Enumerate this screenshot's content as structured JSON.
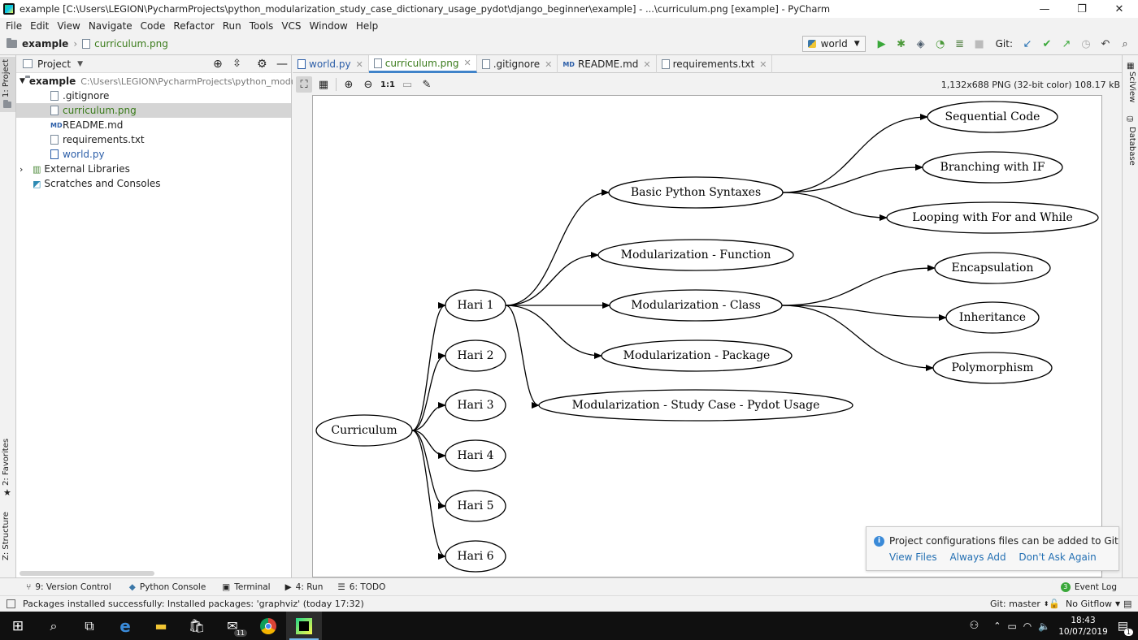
{
  "window": {
    "title": "example [C:\\Users\\LEGION\\PycharmProjects\\python_modularization_study_case_dictionary_usage_pydot\\django_beginner\\example] - ...\\curriculum.png [example] - PyCharm",
    "controls": [
      "—",
      "❐",
      "✕"
    ]
  },
  "menu": [
    "File",
    "Edit",
    "View",
    "Navigate",
    "Code",
    "Refactor",
    "Run",
    "Tools",
    "VCS",
    "Window",
    "Help"
  ],
  "breadcrumb": {
    "project": "example",
    "file": "curriculum.png"
  },
  "run_config": "world",
  "git_label": "Git:",
  "left_strip": {
    "project": "1: Project",
    "favorites": "2: Favorites",
    "structure": "Z: Structure"
  },
  "right_strip": {
    "sciview": "SciView",
    "database": "Database"
  },
  "project_panel": {
    "header": "Project",
    "root": {
      "name": "example",
      "path": "C:\\Users\\LEGION\\PycharmProjects\\python_modulariz"
    },
    "files": [
      {
        "name": ".gitignore",
        "color": "#222222"
      },
      {
        "name": "curriculum.png",
        "color": "#3a7b1a"
      },
      {
        "name": "README.md",
        "color": "#222222"
      },
      {
        "name": "requirements.txt",
        "color": "#222222"
      },
      {
        "name": "world.py",
        "color": "#2c5ea8"
      }
    ],
    "external": "External Libraries",
    "scratches": "Scratches and Consoles"
  },
  "tabs": [
    {
      "label": "world.py",
      "color": "#2c5ea8"
    },
    {
      "label": "curriculum.png",
      "color": "#3a7b1a"
    },
    {
      "label": ".gitignore",
      "color": "#222222"
    },
    {
      "label": "README.md",
      "color": "#222222"
    },
    {
      "label": "requirements.txt",
      "color": "#222222"
    }
  ],
  "image_info": "1,132x688 PNG (32-bit color) 108.17 kB",
  "zoom_label": "1:1",
  "graph": {
    "nodes": {
      "curriculum": "Curriculum",
      "hari1": "Hari 1",
      "hari2": "Hari 2",
      "hari3": "Hari 3",
      "hari4": "Hari 4",
      "hari5": "Hari 5",
      "hari6": "Hari 6",
      "basic": "Basic Python Syntaxes",
      "mod_function": "Modularization - Function",
      "mod_class": "Modularization - Class",
      "mod_package": "Modularization - Package",
      "mod_study": "Modularization - Study Case - Pydot Usage",
      "sequential": "Sequential Code",
      "branching": "Branching with IF",
      "looping": "Looping with For and While",
      "encapsulation": "Encapsulation",
      "inheritance": "Inheritance",
      "polymorphism": "Polymorphism"
    },
    "edges": [
      [
        "curriculum",
        "hari1"
      ],
      [
        "curriculum",
        "hari2"
      ],
      [
        "curriculum",
        "hari3"
      ],
      [
        "curriculum",
        "hari4"
      ],
      [
        "curriculum",
        "hari5"
      ],
      [
        "curriculum",
        "hari6"
      ],
      [
        "hari1",
        "basic"
      ],
      [
        "hari1",
        "mod_function"
      ],
      [
        "hari1",
        "mod_class"
      ],
      [
        "hari1",
        "mod_package"
      ],
      [
        "hari1",
        "mod_study"
      ],
      [
        "basic",
        "sequential"
      ],
      [
        "basic",
        "branching"
      ],
      [
        "basic",
        "looping"
      ],
      [
        "mod_class",
        "encapsulation"
      ],
      [
        "mod_class",
        "inheritance"
      ],
      [
        "mod_class",
        "polymorphism"
      ]
    ]
  },
  "notification": {
    "message": "Project configurations files can be added to Git",
    "actions": [
      "View Files",
      "Always Add",
      "Don't Ask Again"
    ]
  },
  "bottom_tools": [
    {
      "label": "9: Version Control",
      "icon": "version-control-icon"
    },
    {
      "label": "Python Console",
      "icon": "python-console-icon"
    },
    {
      "label": "Terminal",
      "icon": "terminal-icon"
    },
    {
      "label": "4: Run",
      "icon": "run-icon"
    },
    {
      "label": "6: TODO",
      "icon": "todo-icon"
    }
  ],
  "event_log": {
    "count": "3",
    "label": "Event Log"
  },
  "status": {
    "message": "Packages installed successfully: Installed packages: 'graphviz' (today 17:32)",
    "git_branch": "Git: master",
    "gitflow": "No Gitflow"
  },
  "taskbar": {
    "time": "18:43",
    "date": "10/07/2019",
    "mail_badge": "11",
    "notif_badge": "1"
  }
}
